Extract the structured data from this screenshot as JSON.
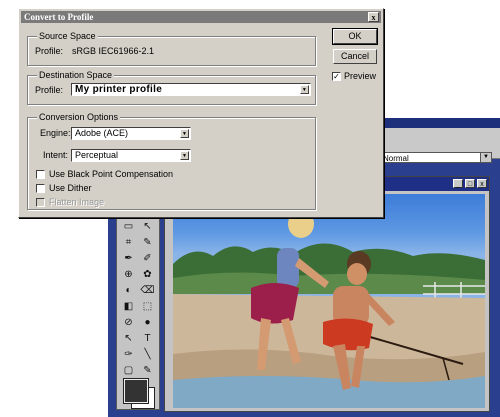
{
  "dialog": {
    "title": "Convert to Profile",
    "close_glyph": "x",
    "source": {
      "legend": "Source Space",
      "profile_label": "Profile:",
      "profile_value": "sRGB IEC61966-2.1"
    },
    "destination": {
      "legend": "Destination Space",
      "profile_label": "Profile:",
      "profile_value": "My printer profile"
    },
    "conversion": {
      "legend": "Conversion Options",
      "engine_label": "Engine:",
      "engine_value": "Adobe (ACE)",
      "intent_label": "Intent:",
      "intent_value": "Perceptual",
      "black_point_label": "Use Black Point Compensation",
      "dither_label": "Use Dither",
      "flatten_label": "Flatten Image"
    },
    "buttons": {
      "ok": "OK",
      "cancel": "Cancel",
      "preview": "Preview",
      "preview_checked": "✓"
    }
  },
  "workspace": {
    "mode_select_value": "Normal",
    "tools": [
      "▭",
      "↖",
      "⌗",
      "✎",
      "✒",
      "✐",
      "⊕",
      "✿",
      "◐",
      "⌫",
      "◧",
      "⬚",
      "⊘",
      "●",
      "↖",
      "T",
      "✑",
      "╲",
      "▢",
      "✎",
      "✋",
      "🔍"
    ]
  },
  "document": {
    "minimize": "_",
    "maximize": "□",
    "close": "x"
  },
  "colors": {
    "dialog_bg": "#d4d0c8",
    "dialog_title_bg": "#7a7a7a",
    "workspace_blue": "#2a3f8e",
    "doc_title_blue": "#1f2f86"
  }
}
